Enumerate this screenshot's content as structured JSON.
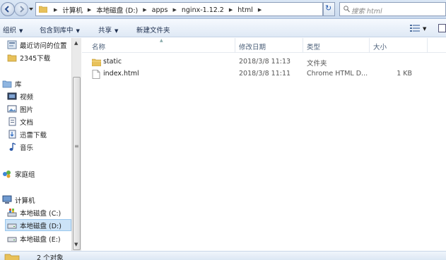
{
  "address": {
    "breadcrumbs": [
      "计算机",
      "本地磁盘 (D:)",
      "apps",
      "nginx-1.12.2",
      "html"
    ]
  },
  "search": {
    "placeholder": "搜索 html"
  },
  "toolbar": {
    "organize": "组织",
    "include_in_library": "包含到库中",
    "share": "共享",
    "new_folder": "新建文件夹"
  },
  "nav": {
    "recent": "最近访问的位置",
    "download2345": "2345下载",
    "libraries": "库",
    "videos": "视频",
    "pictures": "图片",
    "documents": "文档",
    "thunder": "迅雷下载",
    "music": "音乐",
    "homegroup": "家庭组",
    "computer": "计算机",
    "drive_c": "本地磁盘 (C:)",
    "drive_d": "本地磁盘 (D:)",
    "drive_e": "本地磁盘 (E:)"
  },
  "columns": {
    "name": "名称",
    "date": "修改日期",
    "type": "类型",
    "size": "大小"
  },
  "files": [
    {
      "name": "static",
      "date": "2018/3/8 11:13",
      "type": "文件夹",
      "size": "",
      "icon": "folder-icon"
    },
    {
      "name": "index.html",
      "date": "2018/3/8 11:11",
      "type": "Chrome HTML D...",
      "size": "1 KB",
      "icon": "html-file-icon"
    }
  ],
  "status": {
    "count": "2 个对象"
  },
  "colors": {
    "folder": "#e8c15a",
    "selection": "#cce3f7",
    "header_text": "#4c607a"
  }
}
